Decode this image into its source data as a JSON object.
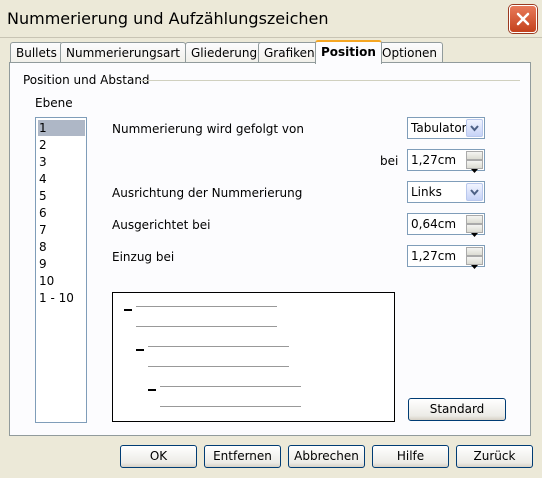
{
  "window": {
    "title": "Nummerierung und Aufzählungszeichen"
  },
  "tabs": [
    {
      "label": "Bullets"
    },
    {
      "label": "Nummerierungsart"
    },
    {
      "label": "Gliederung"
    },
    {
      "label": "Grafiken"
    },
    {
      "label": "Position",
      "active": true
    },
    {
      "label": "Optionen"
    }
  ],
  "group": {
    "title": "Position und Abstand"
  },
  "level_list": {
    "label": "Ebene",
    "items": [
      "1",
      "2",
      "3",
      "4",
      "5",
      "6",
      "7",
      "8",
      "9",
      "10",
      "1 - 10"
    ],
    "selected": "1"
  },
  "fields": {
    "followed_by": {
      "label": "Nummerierung wird gefolgt von",
      "value": "Tabulator"
    },
    "at": {
      "label": "bei",
      "value": "1,27cm"
    },
    "alignment": {
      "label": "Ausrichtung der Nummerierung",
      "value": "Links"
    },
    "aligned_at": {
      "label": "Ausgerichtet bei",
      "value": "0,64cm"
    },
    "indent_at": {
      "label": "Einzug bei",
      "value": "1,27cm"
    }
  },
  "buttons": {
    "standard": "Standard",
    "ok": "OK",
    "remove": "Entfernen",
    "cancel": "Abbrechen",
    "help": "Hilfe",
    "back": "Zurück"
  }
}
